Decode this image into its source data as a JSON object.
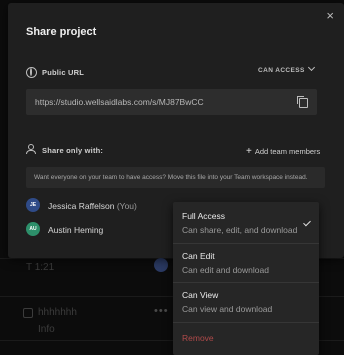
{
  "dialog": {
    "title": "Share project",
    "close_glyph": "×"
  },
  "public_url": {
    "label": "Public URL",
    "access_label": "CAN ACCESS",
    "url": "https://studio.wellsaidlabs.com/s/MJ87BwCC"
  },
  "share_section": {
    "label": "Share only with:",
    "add_button": "Add team members",
    "add_glyph": "+",
    "banner": "Want everyone on your team to have access? Move this file into your Team workspace instead."
  },
  "members": [
    {
      "initials": "JE",
      "name": "Jessica Raffelson",
      "suffix": "(You)",
      "avatar_color": "#2f4b88"
    },
    {
      "initials": "AU",
      "name": "Austin Heming",
      "suffix": "",
      "avatar_color": "#2d8f6a"
    }
  ],
  "permission_menu": {
    "options": [
      {
        "title": "Full Access",
        "description": "Can share, edit, and download",
        "selected": true
      },
      {
        "title": "Can Edit",
        "description": "Can edit and download",
        "selected": false
      },
      {
        "title": "Can View",
        "description": "Can view and download",
        "selected": false
      }
    ],
    "remove_label": "Remove"
  },
  "background": {
    "rows": [
      {
        "title": "",
        "subtitle": "T 1:21"
      },
      {
        "title": "hhhhhhh",
        "subtitle": "Info"
      }
    ],
    "dots": "•••"
  },
  "colors": {
    "modal_bg": "#1f1f1f",
    "field_bg": "#2d2d2d",
    "menu_bg": "#262626",
    "remove_red": "#b04a4a"
  }
}
